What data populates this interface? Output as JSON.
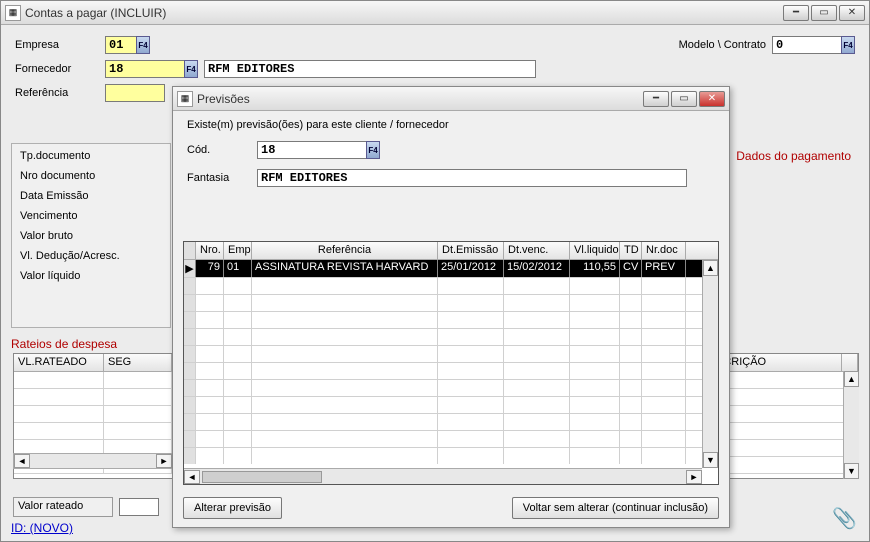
{
  "main": {
    "title": "Contas a pagar (INCLUIR)",
    "labels": {
      "empresa": "Empresa",
      "fornecedor": "Fornecedor",
      "referencia": "Referência",
      "modelo_contrato": "Modelo \\ Contrato"
    },
    "values": {
      "empresa": "01",
      "fornecedor": "18",
      "fornecedor_nome": "RFM EDITORES",
      "contrato": "0"
    },
    "left_box": {
      "tp_documento": "Tp.documento",
      "nro_documento": "Nro documento",
      "data_emissao": "Data Emissão",
      "vencimento": "Vencimento",
      "valor_bruto": "Valor bruto",
      "vl_deducao": "Vl. Dedução/Acresc.",
      "valor_liquido": "Valor líquido"
    },
    "right_panel": "Dados do pagamento",
    "rateios_label": "Rateios de despesa",
    "grid_left_headers": {
      "vl_rateado": "VL.RATEADO",
      "seg": "SEG"
    },
    "right_grid_header": "SCRIÇÃO",
    "valor_rateado_label": "Valor rateado",
    "id_label": "ID: (NOVO)"
  },
  "modal": {
    "title": "Previsões",
    "msg": "Existe(m) previsão(ões) para este cliente / fornecedor",
    "labels": {
      "cod": "Cód.",
      "fantasia": "Fantasia"
    },
    "values": {
      "cod": "18",
      "fantasia": "RFM EDITORES"
    },
    "headers": {
      "nro": "Nro.",
      "emp": "Emp",
      "referencia": "Referência",
      "dt_emissao": "Dt.Emissão",
      "dt_venc": "Dt.venc.",
      "vl_liquido": "Vl.liquido",
      "td": "TD",
      "nr_doc": "Nr.doc"
    },
    "rows": [
      {
        "nro": "79",
        "emp": "01",
        "referencia": "ASSINATURA REVISTA HARVARD",
        "dt_emissao": "25/01/2012",
        "dt_venc": "15/02/2012",
        "vl_liquido": "110,55",
        "td": "CV",
        "nr_doc": "PREV"
      }
    ],
    "buttons": {
      "alterar": "Alterar previsão",
      "voltar": "Voltar sem alterar (continuar inclusão)"
    }
  }
}
